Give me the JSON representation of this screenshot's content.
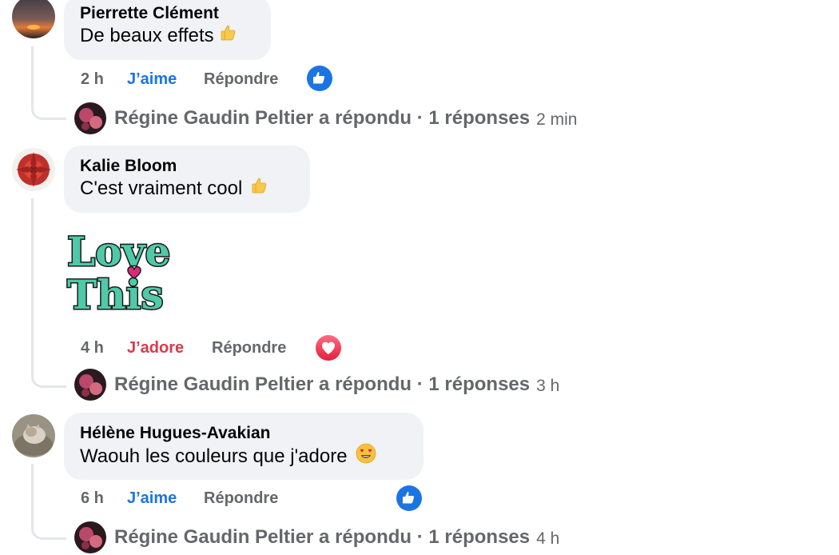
{
  "comments": [
    {
      "author": "Pierrette Clément",
      "text": "De beaux effets",
      "time": "2 h",
      "reaction_label": "J’aime",
      "reply_label": "Répondre",
      "reaction_type": "like",
      "replies_summary": "Régine Gaudin Peltier a répondu · 1 réponses",
      "replies_time": "2 min"
    },
    {
      "author": "Kalie Bloom",
      "text": "C'est vraiment cool",
      "sticker_line1": "Love",
      "sticker_line2": "This",
      "time": "4 h",
      "reaction_label": "J’adore",
      "reply_label": "Répondre",
      "reaction_type": "love",
      "replies_summary": "Régine Gaudin Peltier a répondu · 1 réponses",
      "replies_time": "3 h"
    },
    {
      "author": "Hélène Hugues-Avakian",
      "text": "Waouh les couleurs que j'adore",
      "time": "6 h",
      "reaction_label": "J’aime",
      "reply_label": "Répondre",
      "reaction_type": "like",
      "replies_summary": "Régine Gaudin Peltier a répondu · 1 réponses",
      "replies_time": "4 h"
    }
  ],
  "colors": {
    "bubble": "#f0f2f5",
    "like_blue": "#1b74e4",
    "love_red": "#d93b4a",
    "muted": "#65676b",
    "sticker_teal": "#4fc9a8"
  },
  "icons": [
    "thumbs-up-emoji",
    "heart-eyes-emoji",
    "like-reaction-icon",
    "love-reaction-icon"
  ]
}
